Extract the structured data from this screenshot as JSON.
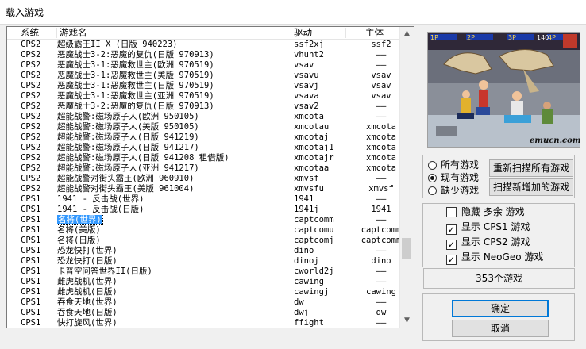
{
  "window": {
    "title": "载入游戏"
  },
  "list": {
    "columns": {
      "system": "系统",
      "name": "游戏名",
      "driver": "驱动",
      "parent": "主体"
    },
    "rows": [
      {
        "system": "CPS2",
        "name": "超级霸王II X (日版 940223)",
        "driver": "ssf2xj",
        "parent": "ssf2"
      },
      {
        "system": "CPS2",
        "name": "恶魔战士3-2:恶魔的复仇(日版 970913)",
        "driver": "vhunt2",
        "parent": "——"
      },
      {
        "system": "CPS2",
        "name": "恶魔战士3-1:恶魔救世主(欧洲 970519)",
        "driver": "vsav",
        "parent": "——"
      },
      {
        "system": "CPS2",
        "name": "恶魔战士3-1:恶魔救世主(美版 970519)",
        "driver": "vsavu",
        "parent": "vsav"
      },
      {
        "system": "CPS2",
        "name": "恶魔战士3-1:恶魔救世主(日版 970519)",
        "driver": "vsavj",
        "parent": "vsav"
      },
      {
        "system": "CPS2",
        "name": "恶魔战士3-1:恶魔救世主(亚洲 970519)",
        "driver": "vsava",
        "parent": "vsav"
      },
      {
        "system": "CPS2",
        "name": "恶魔战士3-2:恶魔的复仇(日版 970913)",
        "driver": "vsav2",
        "parent": "——"
      },
      {
        "system": "CPS2",
        "name": "超能战警:磁场原子人(欧洲 950105)",
        "driver": "xmcota",
        "parent": "——"
      },
      {
        "system": "CPS2",
        "name": "超能战警:磁场原子人(美版 950105)",
        "driver": "xmcotau",
        "parent": "xmcota"
      },
      {
        "system": "CPS2",
        "name": "超能战警:磁场原子人(日版 941219)",
        "driver": "xmcotaj",
        "parent": "xmcota"
      },
      {
        "system": "CPS2",
        "name": "超能战警:磁场原子人(日版 941217)",
        "driver": "xmcotaj1",
        "parent": "xmcota"
      },
      {
        "system": "CPS2",
        "name": "超能战警:磁场原子人(日版 941208 租借版)",
        "driver": "xmcotajr",
        "parent": "xmcota"
      },
      {
        "system": "CPS2",
        "name": "超能战警:磁场原子人(亚洲 941217)",
        "driver": "xmcotaa",
        "parent": "xmcota"
      },
      {
        "system": "CPS2",
        "name": "超能战警对街头霸王(欧洲 960910)",
        "driver": "xmvsf",
        "parent": "——"
      },
      {
        "system": "CPS2",
        "name": "超能战警对街头霸王(美版 961004)",
        "driver": "xmvsfu",
        "parent": "xmvsf"
      },
      {
        "system": "CPS1",
        "name": "1941 - 反击战(世界)",
        "driver": "1941",
        "parent": "——"
      },
      {
        "system": "CPS1",
        "name": "1941 - 反击战(日版)",
        "driver": "1941j",
        "parent": "1941"
      },
      {
        "system": "CPS1",
        "name": "名将(世界)",
        "driver": "captcomm",
        "parent": "——",
        "selected": true
      },
      {
        "system": "CPS1",
        "name": "名将(美版)",
        "driver": "captcomu",
        "parent": "captcomm"
      },
      {
        "system": "CPS1",
        "name": "名将(日版)",
        "driver": "captcomj",
        "parent": "captcomm"
      },
      {
        "system": "CPS1",
        "name": "恐龙快打(世界)",
        "driver": "dino",
        "parent": "——"
      },
      {
        "system": "CPS1",
        "name": "恐龙快打(日版)",
        "driver": "dinoj",
        "parent": "dino"
      },
      {
        "system": "CPS1",
        "name": "卡普空问答世界II(日版)",
        "driver": "cworld2j",
        "parent": "——"
      },
      {
        "system": "CPS1",
        "name": "雌虎战机(世界)",
        "driver": "cawing",
        "parent": "——"
      },
      {
        "system": "CPS1",
        "name": "雌虎战机(日版)",
        "driver": "cawingj",
        "parent": "cawing"
      },
      {
        "system": "CPS1",
        "name": "吞食天地(世界)",
        "driver": "dw",
        "parent": "——"
      },
      {
        "system": "CPS1",
        "name": "吞食天地(日版)",
        "driver": "dwj",
        "parent": "dw"
      },
      {
        "system": "CPS1",
        "name": "快打旋风(世界)",
        "driver": "ffight",
        "parent": "——"
      }
    ],
    "scroll_position": 0.78
  },
  "preview": {
    "hud": [
      "1P",
      "2P",
      "3P",
      "4P",
      "140"
    ],
    "watermark": "emucn.com"
  },
  "filter": {
    "options": [
      {
        "label": "所有游戏",
        "checked": false
      },
      {
        "label": "现有游戏",
        "checked": true
      },
      {
        "label": "缺少游戏",
        "checked": false
      }
    ],
    "rescan_all": "重新扫描所有游戏",
    "rescan_new": "扫描新增加的游戏"
  },
  "display": {
    "options": [
      {
        "label": "隐藏 多余 游戏",
        "checked": false
      },
      {
        "label": "显示 CPS1 游戏",
        "checked": true
      },
      {
        "label": "显示 CPS2 游戏",
        "checked": true
      },
      {
        "label": "显示 NeoGeo 游戏",
        "checked": true
      }
    ]
  },
  "count_label": "353个游戏",
  "buttons": {
    "ok": "确定",
    "cancel": "取消"
  }
}
